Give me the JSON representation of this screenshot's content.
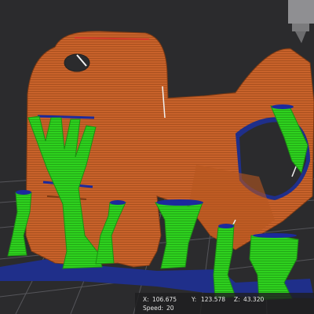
{
  "viewport": {
    "name": "3d-slice-preview",
    "colors": {
      "background": "#2b2b2d",
      "grid_line": "#5a5a5e",
      "bed_plate": "#1f2f8a",
      "model_orange": "#c8622a",
      "model_orange_dark": "#9c4a1f",
      "support_green": "#2ed11e",
      "support_green_dark": "#1e9a14",
      "edge_blue": "#1b2a9c",
      "nozzle": "#8a8a8a"
    }
  },
  "readout": {
    "x_label": "X:",
    "x_value": "106.675",
    "y_label": "Y:",
    "y_value": "123.578",
    "z_label": "Z:",
    "z_value": "43.320",
    "speed_label": "Speed:",
    "speed_value": "20"
  }
}
